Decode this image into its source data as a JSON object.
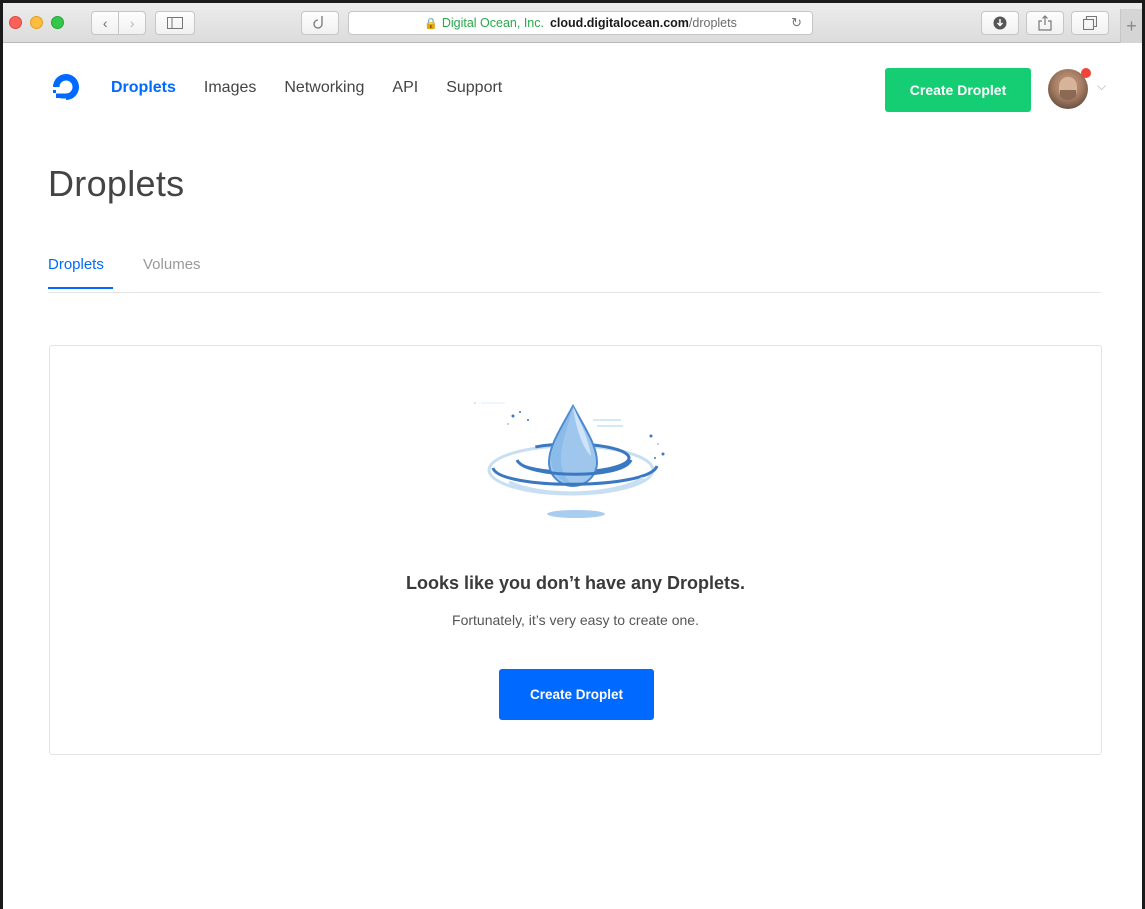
{
  "browser": {
    "address": {
      "org": "Digital Ocean, Inc.",
      "host": "cloud.digitalocean.com",
      "path": "/droplets"
    },
    "icons": [
      "back-icon",
      "forward-icon",
      "sidebar-icon",
      "share-tab-icon",
      "lock-icon",
      "reload-icon",
      "download-icon",
      "share-icon",
      "tabs-icon",
      "plus-icon"
    ]
  },
  "header": {
    "nav": [
      "Droplets",
      "Images",
      "Networking",
      "API",
      "Support"
    ],
    "active_nav": "Droplets",
    "create_label": "Create Droplet"
  },
  "page": {
    "title": "Droplets",
    "tabs": [
      "Droplets",
      "Volumes"
    ],
    "active_tab": "Droplets"
  },
  "empty_state": {
    "title": "Looks like you don’t have any Droplets.",
    "subtitle": "Fortunately, it’s very easy to create one.",
    "button_label": "Create Droplet"
  },
  "colors": {
    "brand_blue": "#0069ff",
    "create_green": "#15cd72",
    "notification_red": "#f0443b"
  }
}
